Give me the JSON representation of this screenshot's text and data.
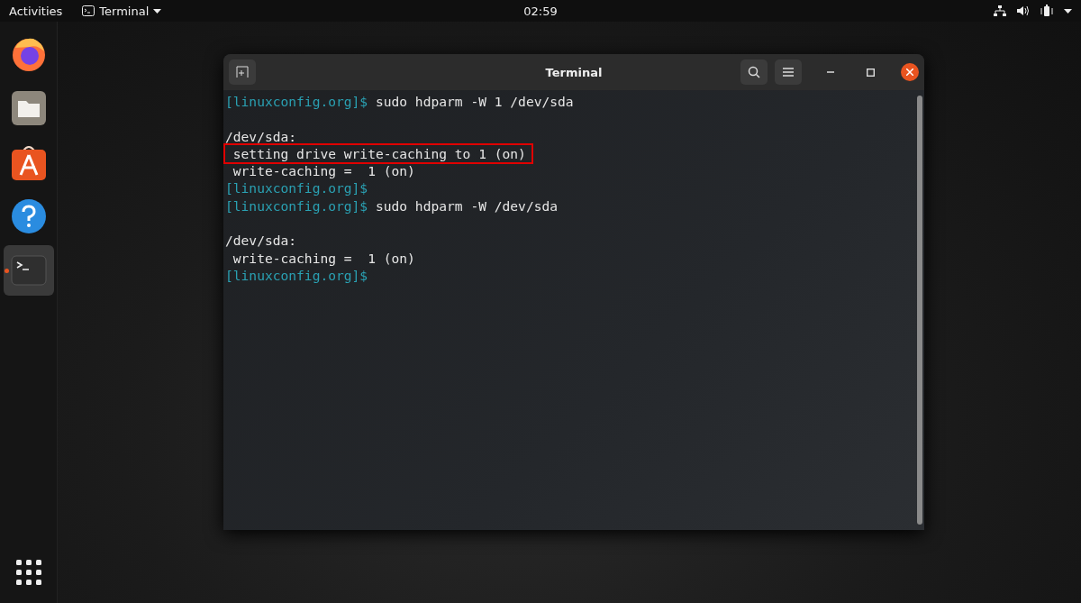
{
  "top_bar": {
    "activities": "Activities",
    "app_menu": "Terminal",
    "clock": "02:59"
  },
  "dock": {
    "items": [
      {
        "kind": "browser",
        "running": false
      },
      {
        "kind": "files",
        "running": false
      },
      {
        "kind": "store",
        "running": false
      },
      {
        "kind": "help",
        "running": false
      },
      {
        "kind": "terminal",
        "running": true
      }
    ]
  },
  "terminal": {
    "title": "Terminal",
    "lines": [
      {
        "kind": "prompt",
        "prompt": "[linuxconfig.org]$",
        "command": "sudo hdparm -W 1 /dev/sda"
      },
      {
        "kind": "blank"
      },
      {
        "kind": "output",
        "text": "/dev/sda:",
        "highlighted": false
      },
      {
        "kind": "output",
        "text": " setting drive write-caching to 1 (on)",
        "highlighted": true
      },
      {
        "kind": "output",
        "text": " write-caching =  1 (on)",
        "highlighted": false
      },
      {
        "kind": "prompt",
        "prompt": "[linuxconfig.org]$"
      },
      {
        "kind": "prompt",
        "prompt": "[linuxconfig.org]$",
        "command": "sudo hdparm -W /dev/sda"
      },
      {
        "kind": "blank"
      },
      {
        "kind": "output",
        "text": "/dev/sda:",
        "highlighted": false
      },
      {
        "kind": "output",
        "text": " write-caching =  1 (on)",
        "highlighted": false
      },
      {
        "kind": "prompt",
        "prompt": "[linuxconfig.org]$"
      }
    ]
  }
}
